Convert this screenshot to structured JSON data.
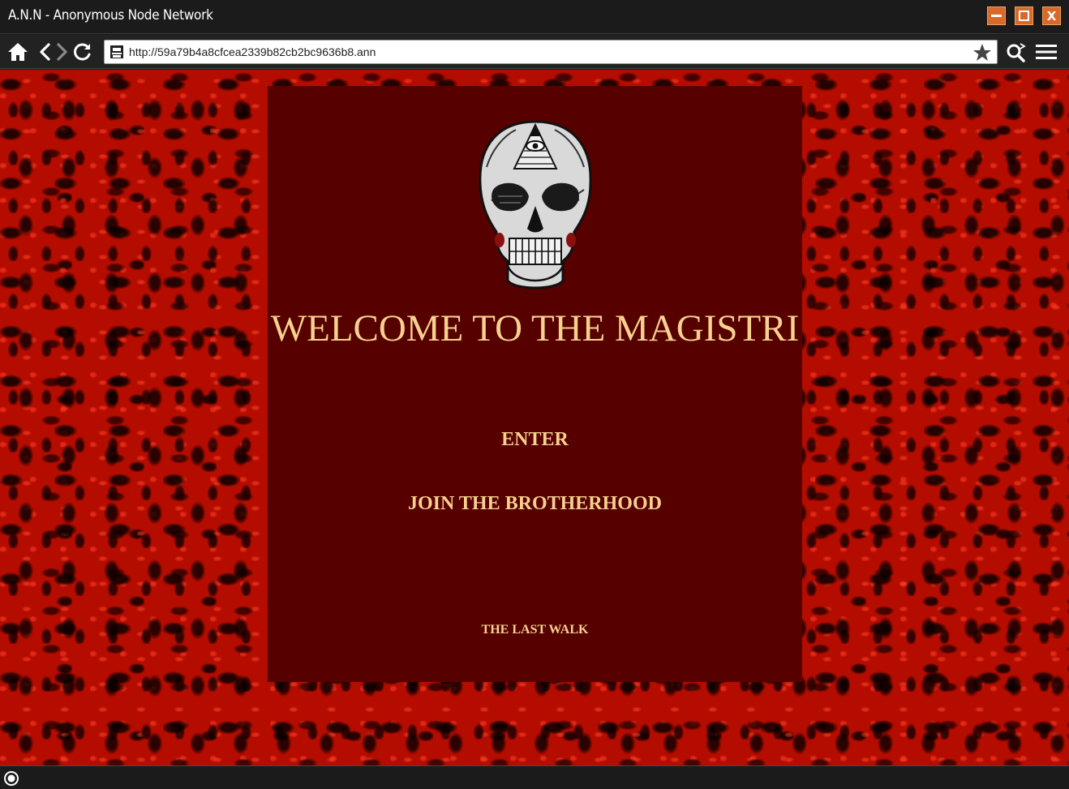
{
  "window": {
    "title": "A.N.N - Anonymous Node Network",
    "minimize_label": "",
    "maximize_label": "",
    "close_label": "X"
  },
  "toolbar": {
    "url": "http://59a79b4a8cfcea2339b82cb2bc9636b8.ann",
    "icons": [
      "home-icon",
      "back-icon",
      "forward-icon",
      "reload-icon",
      "site-identity-icon",
      "bookmark-star-icon",
      "search-icon",
      "menu-icon"
    ]
  },
  "page": {
    "heading": "WELCOME TO THE MAGISTRI",
    "links": {
      "enter": "ENTER",
      "join": "JOIN THE BROTHERHOOD",
      "last_walk": "THE LAST WALK"
    },
    "colors": {
      "text": "#f6d18e",
      "panel": "#570000",
      "background": "#b50c00",
      "window_button": "#d8692a"
    }
  },
  "statusbar": {
    "icon": "status-indicator-icon"
  }
}
